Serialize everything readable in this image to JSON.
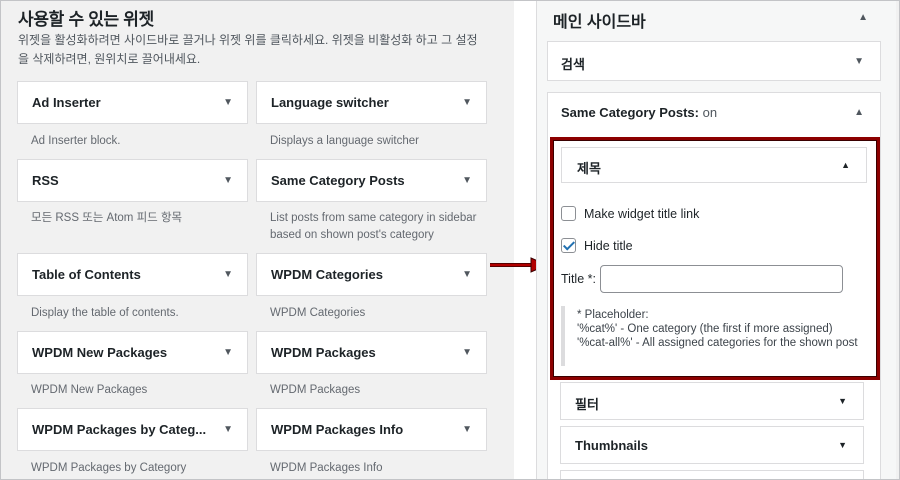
{
  "available": {
    "title": "사용할 수 있는 위젯",
    "description": "위젯을 활성화하려면 사이드바로 끌거나 위젯 위를 클릭하세요. 위젯을 비활성화 하고 그 설정을 삭제하려면, 원위치로 끌어내세요.",
    "widgets": [
      {
        "label": "Ad Inserter",
        "desc": "Ad Inserter block."
      },
      {
        "label": "Language switcher",
        "desc": "Displays a language switcher"
      },
      {
        "label": "RSS",
        "desc": "모든 RSS 또는 Atom 피드 항목"
      },
      {
        "label": "Same Category Posts",
        "desc": "List posts from same category in sidebar based on shown post's category"
      },
      {
        "label": "Table of Contents",
        "desc": "Display the table of contents."
      },
      {
        "label": "WPDM Categories",
        "desc": "WPDM Categories"
      },
      {
        "label": "WPDM New Packages",
        "desc": "WPDM New Packages"
      },
      {
        "label": "WPDM Packages",
        "desc": "WPDM Packages"
      },
      {
        "label": "WPDM Packages by Categ...",
        "desc": "WPDM Packages by Category"
      },
      {
        "label": "WPDM Packages Info",
        "desc": "WPDM Packages Info"
      }
    ]
  },
  "sidebar": {
    "title": "메인 사이드바",
    "search_widget": "검색",
    "scp_widget": {
      "label": "Same Category Posts:",
      "suffix": " on"
    },
    "panel": {
      "section_title": "제목",
      "make_link_label": "Make widget title link",
      "make_link_checked": false,
      "hide_title_label": "Hide title",
      "hide_title_checked": true,
      "title_field_label": "Title *:",
      "title_value": "",
      "help_line1": "* Placeholder:",
      "help_line2": "'%cat%' - One category (the first if more assigned)",
      "help_line3": "'%cat-all%' - All assigned categories for the shown post"
    },
    "sub_sections": [
      "필터",
      "Thumbnails"
    ]
  },
  "icons": {
    "caret_down": "▼",
    "caret_up": "▲"
  },
  "colors": {
    "highlight": "#8c0000",
    "arrow": "#b10000",
    "check": "#2271b1"
  }
}
